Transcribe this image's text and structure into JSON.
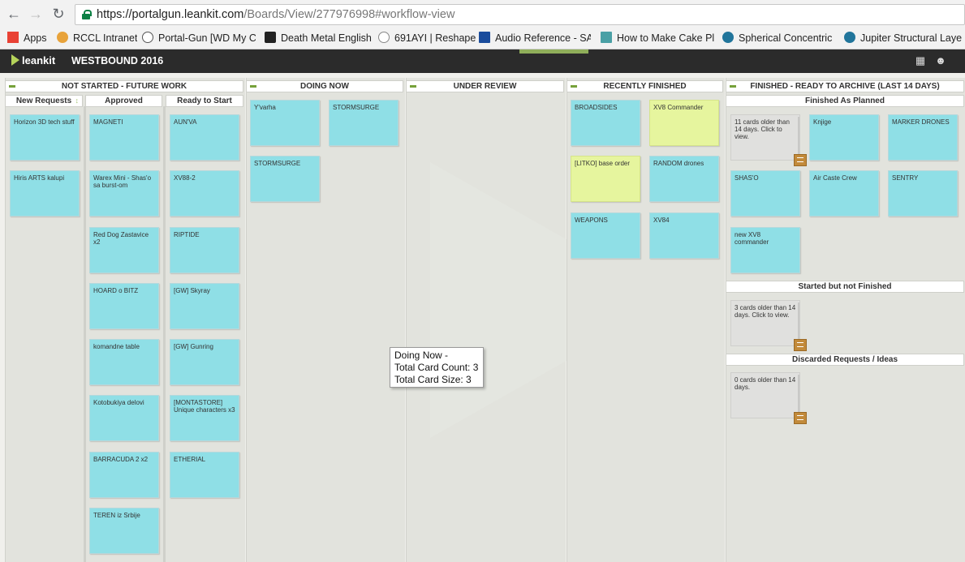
{
  "browser": {
    "url_host": "https://portalgun.leankit.com",
    "url_path": "/Boards/View/277976998#workflow-view",
    "bookmarks": [
      {
        "label": "Apps",
        "color": "#e94235"
      },
      {
        "label": "RCCL Intranet",
        "color": "#e8a33b"
      },
      {
        "label": "Portal-Gun [WD My C",
        "color": "#555555"
      },
      {
        "label": "Death Metal English",
        "color": "#222222"
      },
      {
        "label": "691AYI | Reshape",
        "color": "#888888"
      },
      {
        "label": "Audio Reference - SAI",
        "color": "#1a4c9c"
      },
      {
        "label": "How to Make Cake Pl",
        "color": "#4aa0a5"
      },
      {
        "label": "Spherical Concentric L",
        "color": "#21759b"
      },
      {
        "label": "Jupiter Structural Laye",
        "color": "#21759b"
      }
    ]
  },
  "app": {
    "logo": "leankit",
    "board_title": "WESTBOUND 2016"
  },
  "lanes": {
    "not_started": {
      "title": "NOT STARTED - FUTURE WORK",
      "new_requests": {
        "title": "New Requests",
        "cards": [
          "Horizon 3D tech stuff",
          "Hiris ARTS kalupi"
        ]
      },
      "approved": {
        "title": "Approved",
        "cards": [
          "MAGNETI",
          "Warex Mini - Shas'o sa burst-om",
          "Red Dog Zastavice x2",
          "HOARD o BITZ",
          "komandne table",
          "Kotobukiya delovi",
          "BARRACUDA 2 x2",
          "TEREN iz Srbije"
        ]
      },
      "ready": {
        "title": "Ready to Start",
        "cards": [
          "AUN'VA",
          "XV88-2",
          "RIPTIDE",
          "[GW] Skyray",
          "[GW] Gunring",
          "[MONTASTORE] Unique characters x3",
          "ETHERIAL"
        ]
      }
    },
    "doing_now": {
      "title": "DOING NOW",
      "cards": [
        "Y'varha",
        "STORMSURGE",
        "STORMSURGE"
      ]
    },
    "under_review": {
      "title": "UNDER REVIEW"
    },
    "recently_finished": {
      "title": "RECENTLY FINISHED",
      "cards": [
        "BROADSIDES",
        "XV8 Commander",
        "[LITKO] base order",
        "RANDOM drones",
        "WEAPONS",
        "XV84"
      ]
    },
    "finished": {
      "title": "FINISHED - READY TO ARCHIVE (LAST 14 DAYS)",
      "planned": {
        "title": "Finished As Planned",
        "summary": "11 cards older than 14 days. Click to view.",
        "cards": [
          "Knjige",
          "MARKER DRONES",
          "SHAS'O",
          "Air Caste Crew",
          "SENTRY",
          "new XV8 commander"
        ]
      },
      "not_finished": {
        "title": "Started but not Finished",
        "summary": "3 cards older than 14 days. Click to view."
      },
      "discarded": {
        "title": "Discarded Requests / Ideas",
        "summary": "0 cards older than 14 days."
      }
    }
  },
  "tooltip": {
    "line1": "Doing Now -",
    "line2": "Total Card Count: 3",
    "line3": "Total Card Size: 3"
  }
}
